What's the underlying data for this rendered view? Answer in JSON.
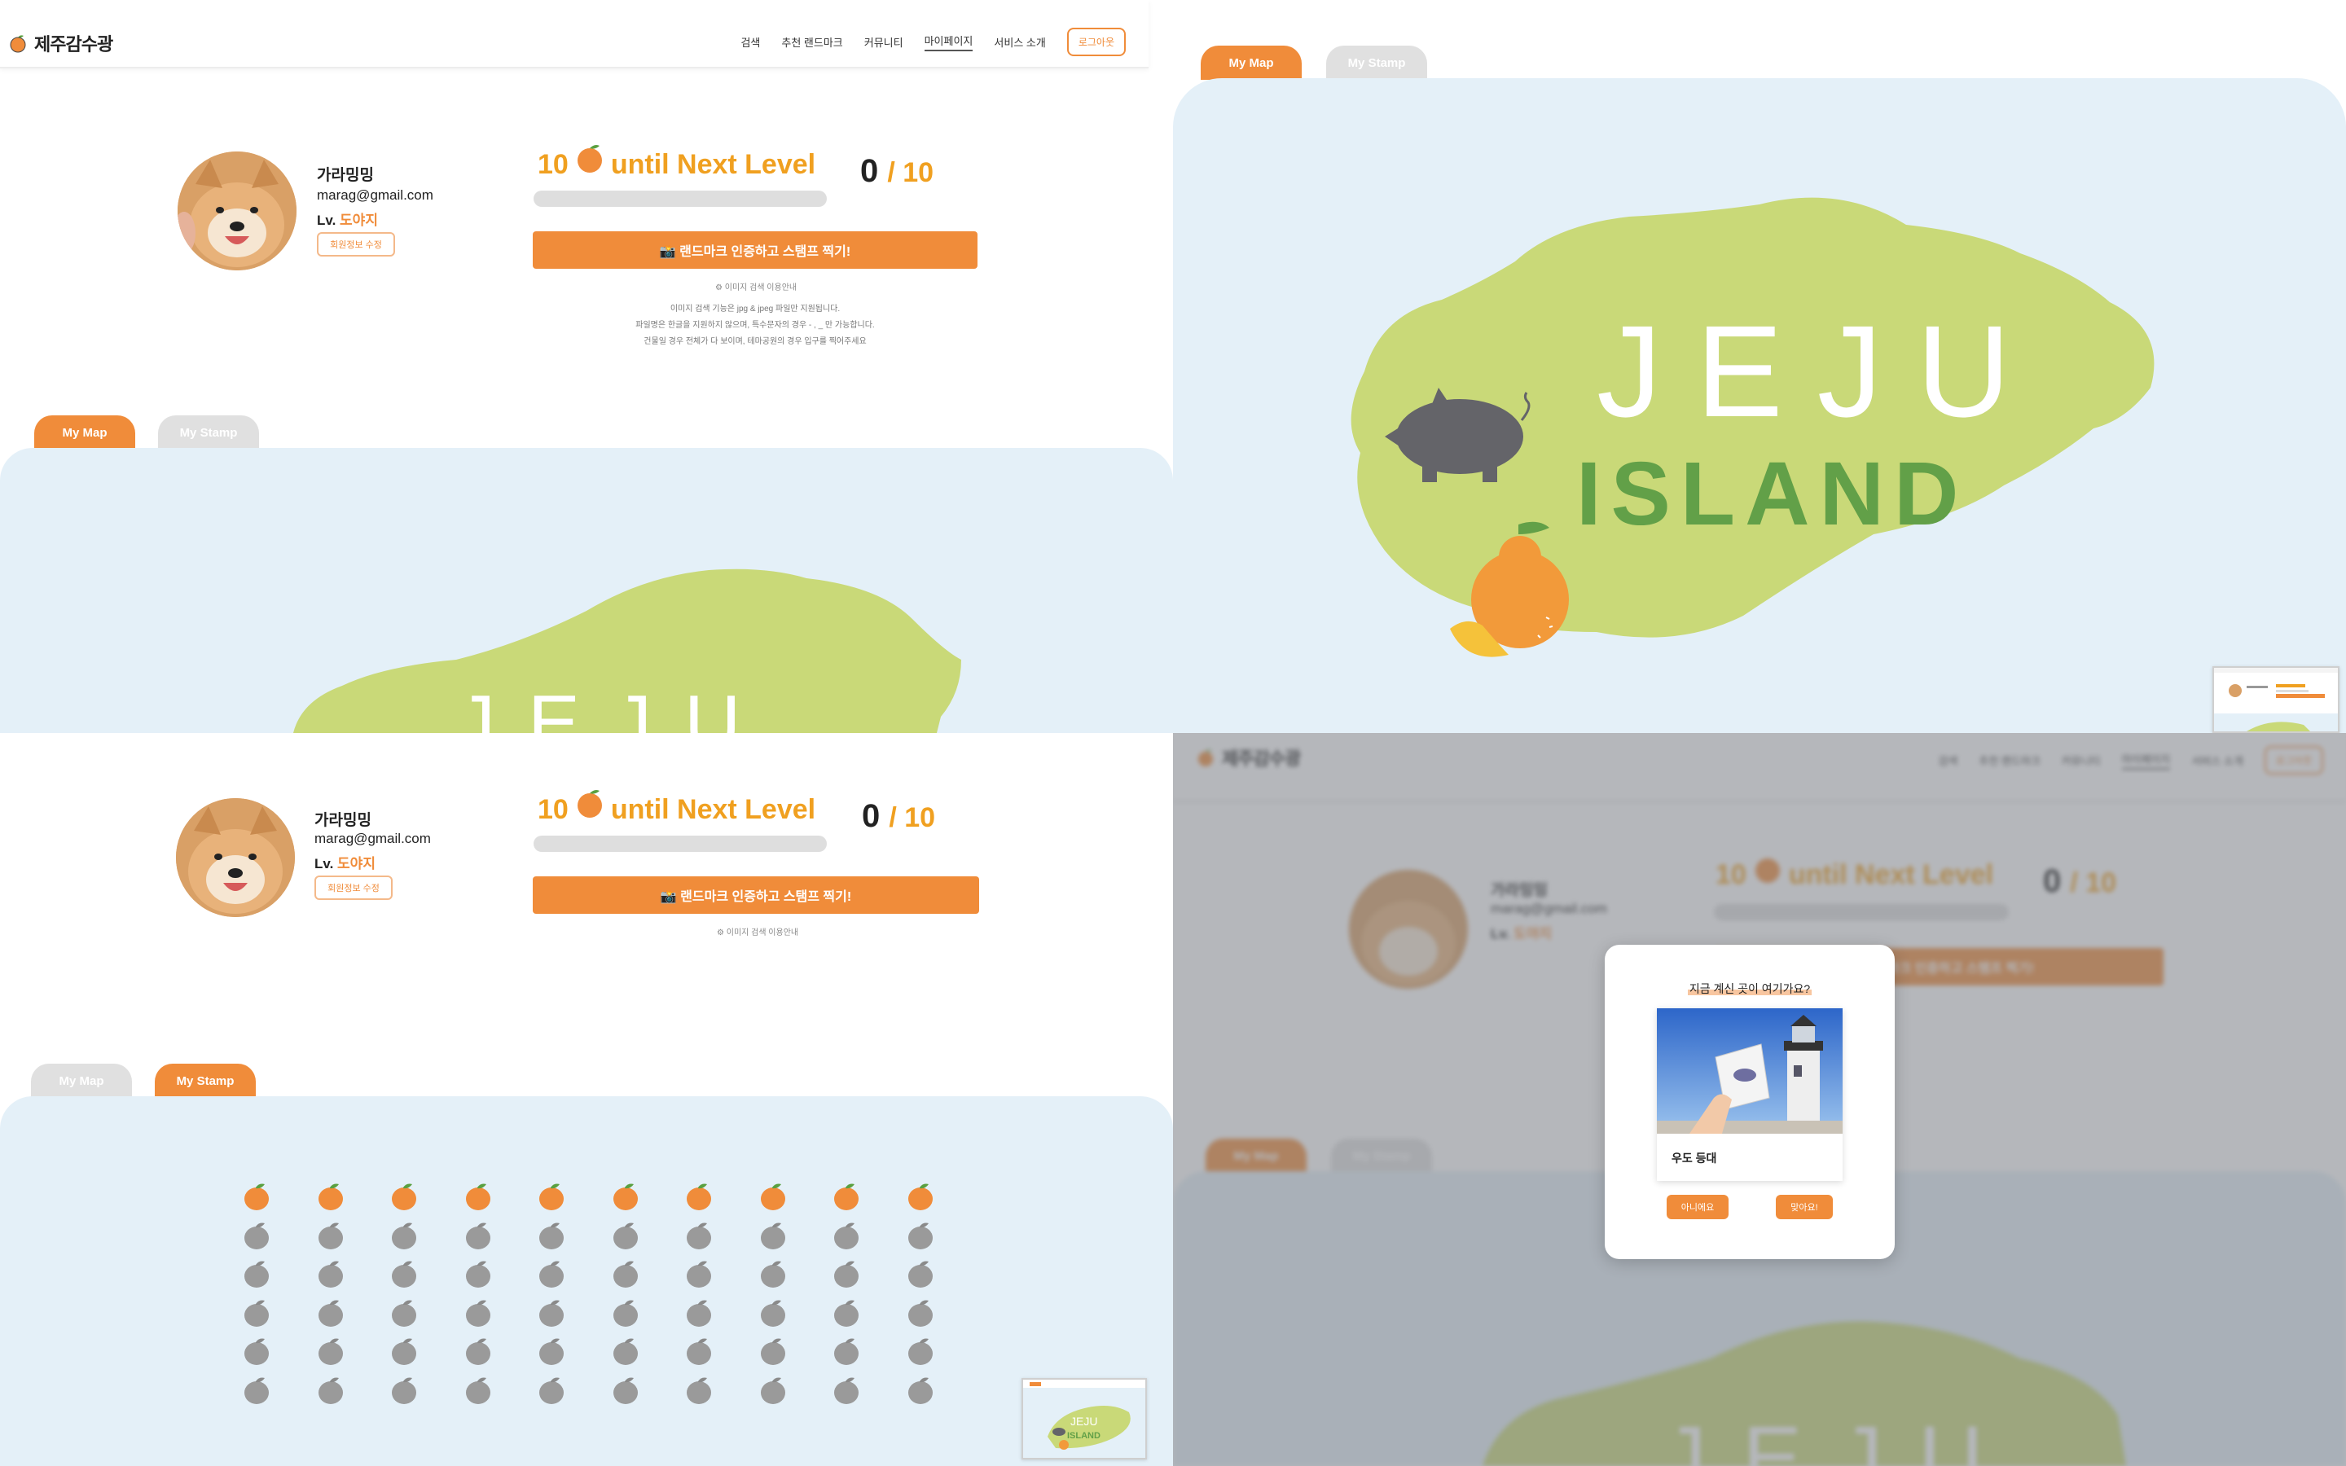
{
  "brand": {
    "name": "제주감수광",
    "accent": "#f08c3a"
  },
  "nav": {
    "items": [
      "검색",
      "추천 랜드마크",
      "커뮤니티",
      "마이페이지",
      "서비스 소개"
    ],
    "active_index": 3,
    "logout": "로그아웃"
  },
  "profile": {
    "name": "가라밍밍",
    "email": "marag@gmail.com",
    "level_prefix": "Lv.",
    "level_name": "도야지",
    "edit_button": "회원정보 수정"
  },
  "level": {
    "remaining": "10",
    "until_text": "until Next Level",
    "current": "0",
    "max": "/ 10",
    "progress_fraction": 0
  },
  "stamp_button": "📸 랜드마크 인증하고 스탬프 찍기!",
  "guide": {
    "link": "이미지 검색 이용안내",
    "lines": [
      "이미지 검색 기능은 jpg & jpeg 파일만 지원됩니다.",
      "파일명은 한글을 지원하지 않으며, 특수문자의 경우 - , _ 만 가능합니다.",
      "건물일 경우 전체가 다 보이며, 테마공원의 경우 입구를 찍어주세요"
    ]
  },
  "tabs": {
    "map": "My Map",
    "stamp": "My Stamp"
  },
  "map_art": {
    "line1": "JEJU",
    "line2": "ISLAND"
  },
  "stamps": {
    "total": 60,
    "collected": 10,
    "columns": 10
  },
  "modal": {
    "question": "지금 계신 곳이 여기가요?",
    "place": "우도 등대",
    "no_button": "아니에요",
    "yes_button": "맞아요!"
  },
  "colors": {
    "accent": "#f08c3a",
    "level_gold": "#f0a020",
    "map_bg": "#e4f0f8",
    "island": "#c9d978",
    "island_text_dark": "#62a048",
    "stamp_empty": "#9a9a9a"
  },
  "icons": [
    "tangerine-icon",
    "camera-icon",
    "gear-icon",
    "pig-icon"
  ]
}
